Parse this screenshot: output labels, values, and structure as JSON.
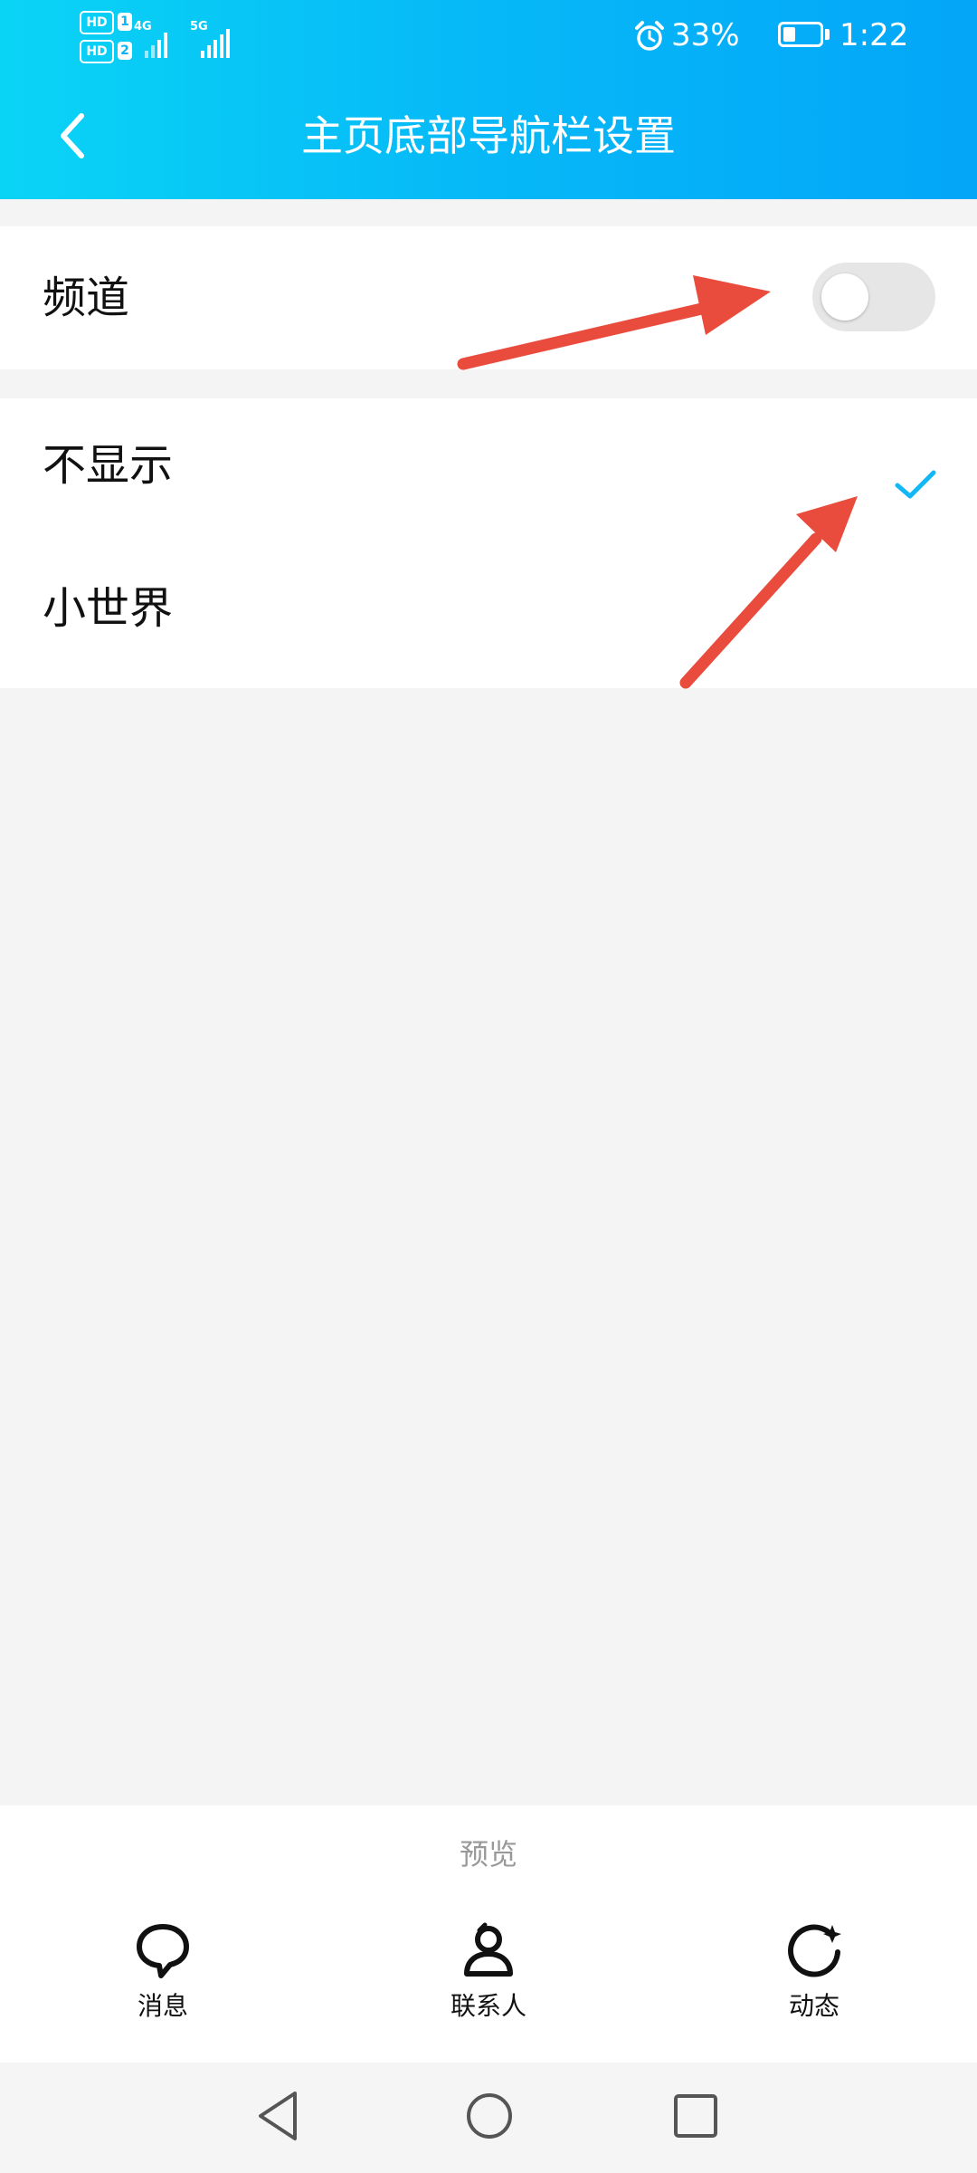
{
  "status_bar": {
    "sim1_label": "HD",
    "sim1_num": "1",
    "sim2_label": "HD",
    "sim2_num": "2",
    "net1": "4G",
    "net2": "5G",
    "battery_percent": "33%",
    "battery_level": 0.33,
    "time": "1:22"
  },
  "header": {
    "title": "主页底部导航栏设置"
  },
  "channel_row": {
    "label": "频道",
    "toggle_on": false
  },
  "options": [
    {
      "label": "不显示",
      "selected": true
    },
    {
      "label": "小世界",
      "selected": false
    }
  ],
  "preview": {
    "title": "预览",
    "tabs": [
      {
        "label": "消息",
        "icon": "chat-bubble-icon"
      },
      {
        "label": "联系人",
        "icon": "person-icon"
      },
      {
        "label": "动态",
        "icon": "refresh-star-icon"
      }
    ]
  },
  "colors": {
    "header_gradient_start": "#0ad4f6",
    "header_gradient_end": "#04a6f8",
    "accent": "#12b7f5",
    "annotation_arrow": "#e94b3c",
    "background": "#f4f4f4"
  }
}
